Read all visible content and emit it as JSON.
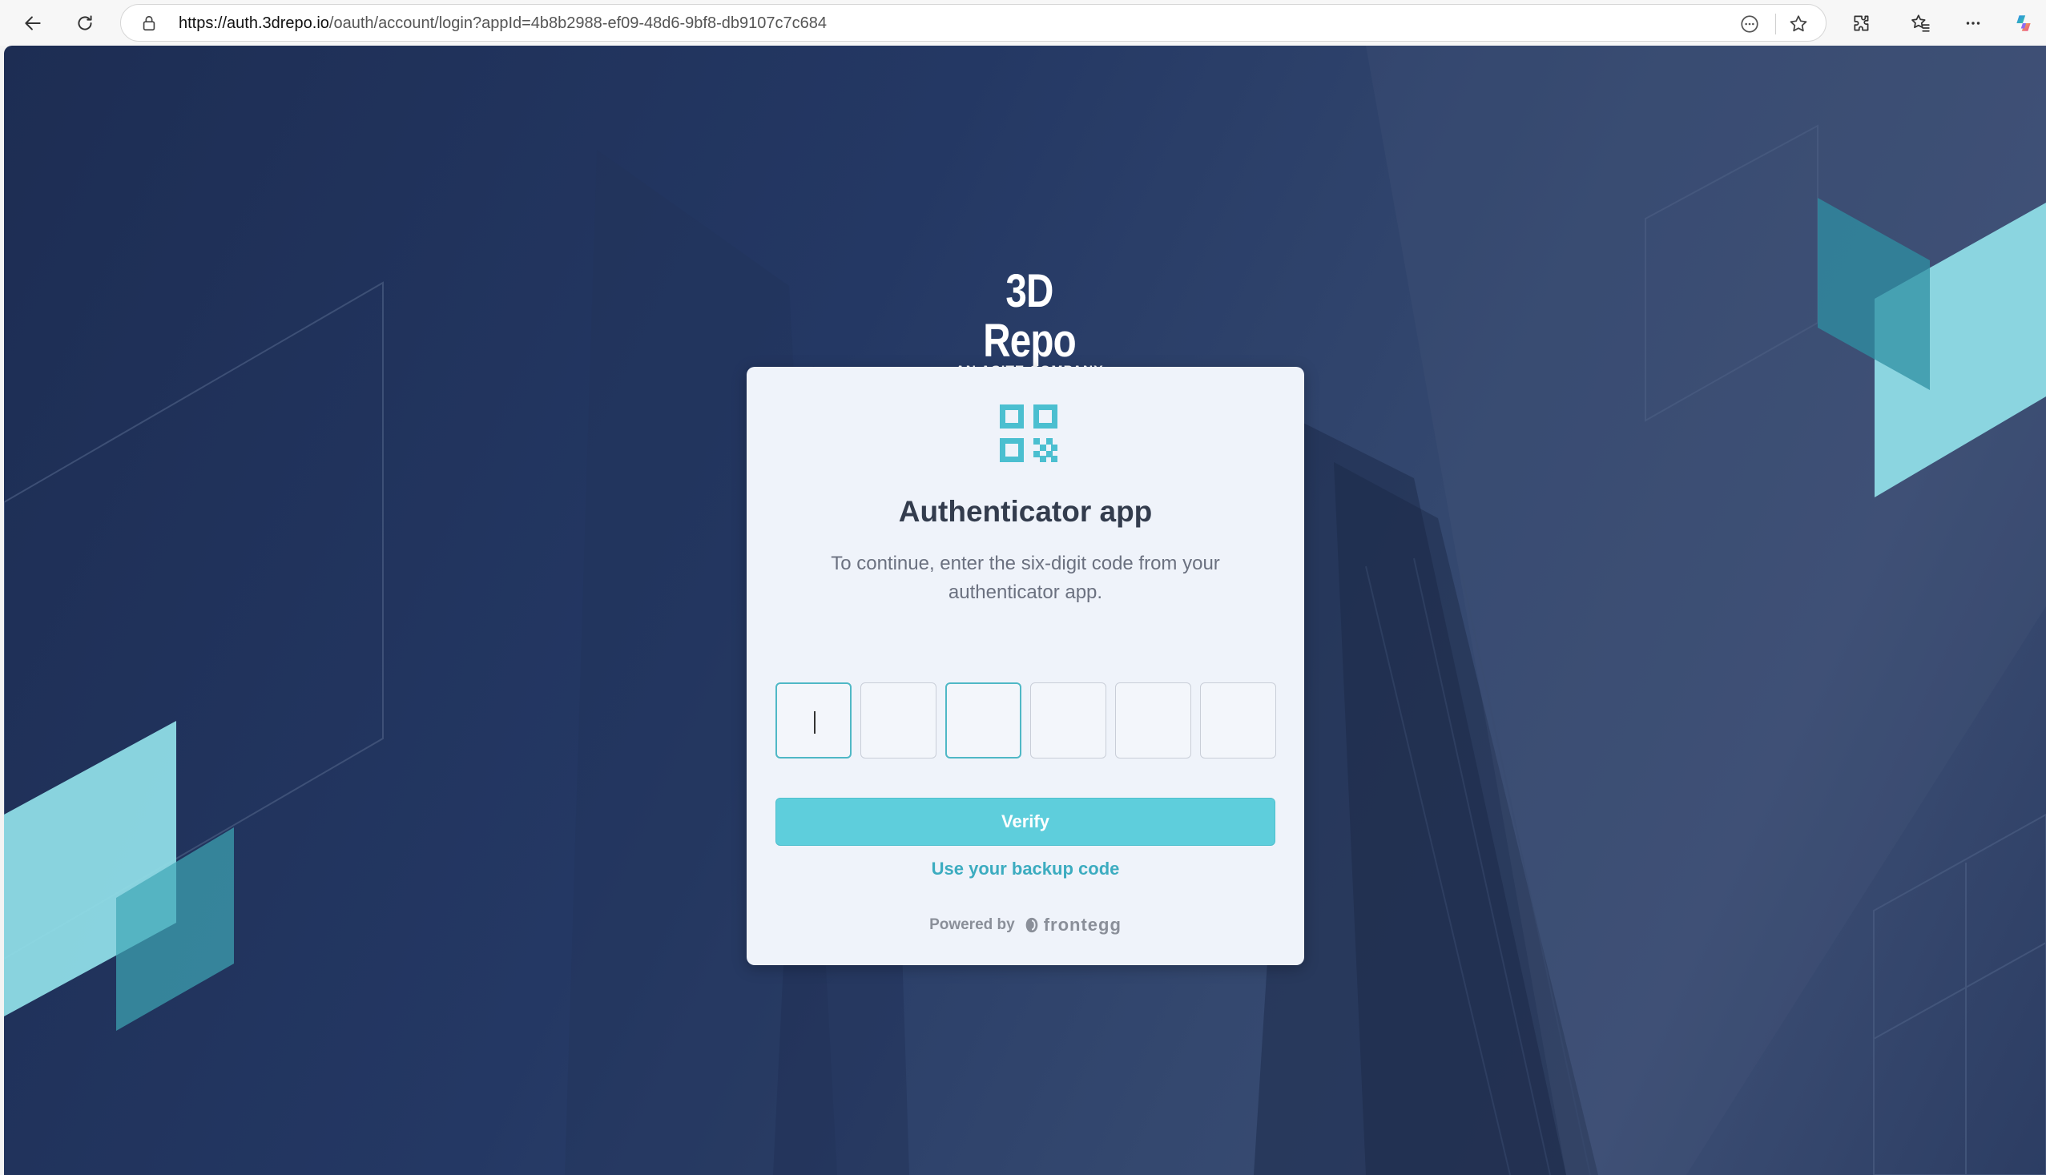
{
  "browser": {
    "url_host": "https://auth.3drepo.io",
    "url_path": "/oauth/account/login?appId=4b8b2988-ef09-48d6-9bf8-db9107c7c684",
    "icons": [
      "back-icon",
      "refresh-icon",
      "lock-icon",
      "read-aloud-icon",
      "favorite-star-icon",
      "extensions-icon",
      "favorites-icon",
      "more-icon",
      "copilot-icon"
    ]
  },
  "logo": {
    "main": "3D Repo",
    "sub": "AN ASITE COMPANY"
  },
  "card": {
    "icon": "qr-code-icon",
    "title": "Authenticator app",
    "description": "To continue, enter the six-digit code from your authenticator app.",
    "code_digits": [
      "",
      "",
      "",
      "",
      "",
      ""
    ],
    "verify_label": "Verify",
    "backup_link": "Use your backup code",
    "powered_by": "Powered by",
    "provider": "frontegg"
  },
  "colors": {
    "accent": "#5ecedc",
    "link": "#3cacc0",
    "title": "#333c4d",
    "background_dark": "#1d2d53"
  }
}
